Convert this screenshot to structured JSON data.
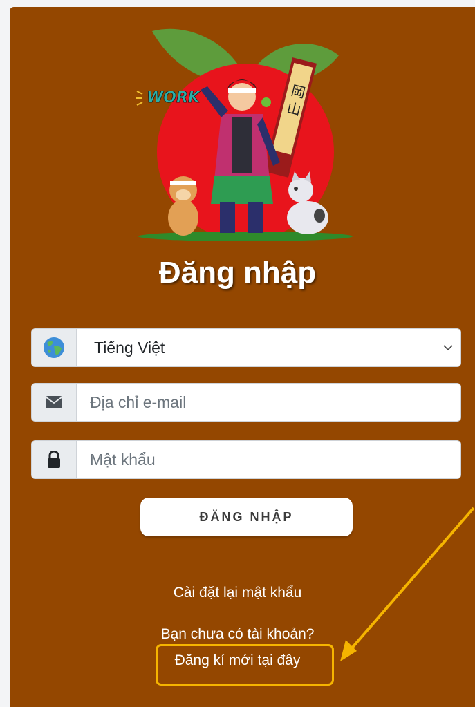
{
  "page": {
    "title": "Đăng nhập",
    "language_select": {
      "value": "Tiếng Việt",
      "icon": "globe-icon"
    },
    "email_field": {
      "placeholder": "Địa chỉ e-mail",
      "icon": "envelope-icon"
    },
    "password_field": {
      "placeholder": "Mật khẩu",
      "icon": "lock-icon"
    },
    "login_button_label": "ĐĂNG NHẬP",
    "reset_password_link": "Cài đặt lại mật khẩu",
    "no_account_text": "Bạn chưa có tài khoản?",
    "register_link": "Đăng kí mới tại đây",
    "hero": {
      "work_badge": "WORK",
      "banner_glyphs": [
        "岡",
        "山"
      ]
    }
  },
  "colors": {
    "card_background": "#944700",
    "highlight": "#f5b400",
    "hero_circle": "#e8141c"
  }
}
